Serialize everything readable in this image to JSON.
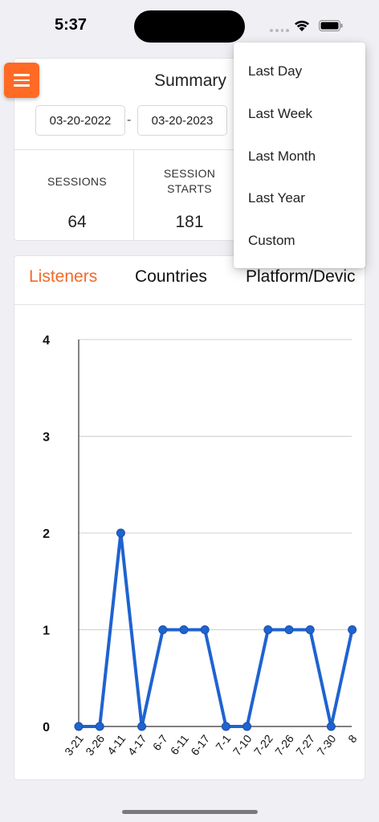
{
  "status_bar": {
    "time": "5:37"
  },
  "summary": {
    "title": "Summary",
    "start_date": "03-20-2022",
    "separator": "-",
    "end_date": "03-20-2023",
    "stats": [
      {
        "label_line1": "SESSIONS",
        "label_line2": "",
        "value": "64"
      },
      {
        "label_line1": "SESSION",
        "label_line2": "STARTS",
        "value": "181"
      }
    ]
  },
  "tabs": [
    {
      "label": "Listeners",
      "active": true
    },
    {
      "label": "Countries",
      "active": false
    },
    {
      "label": "Platform/Devic",
      "active": false
    }
  ],
  "dropdown": {
    "items": [
      "Last Day",
      "Last Week",
      "Last Month",
      "Last Year",
      "Custom"
    ]
  },
  "colors": {
    "accent": "#ff6a24",
    "active_tab": "#f06a2a",
    "series": "#1f63d0"
  },
  "chart_data": {
    "type": "line",
    "title": "",
    "xlabel": "",
    "ylabel": "",
    "ylim": [
      0,
      4
    ],
    "y_ticks": [
      0,
      1,
      2,
      3,
      4
    ],
    "grid": true,
    "categories": [
      "3-21",
      "3-26",
      "4-11",
      "4-17",
      "6-7",
      "6-11",
      "6-17",
      "7-1",
      "7-10",
      "7-22",
      "7-26",
      "7-27",
      "7-30",
      "8"
    ],
    "series": [
      {
        "values": [
          0,
          0,
          2,
          0,
          1,
          1,
          1,
          0,
          0,
          1,
          1,
          1,
          0,
          1
        ]
      }
    ]
  }
}
